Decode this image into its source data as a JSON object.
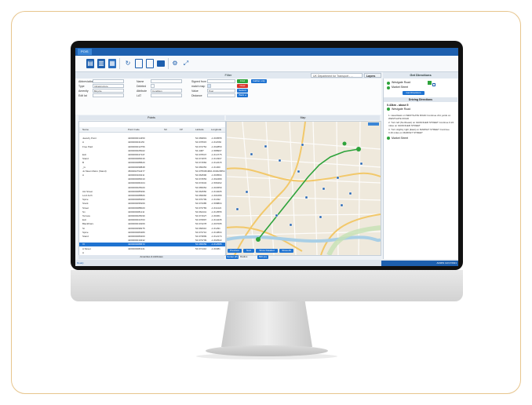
{
  "app": {
    "menu_tab": "POIS",
    "filter": {
      "title": "Filter",
      "dropdown": "UK Department for Transport - ...",
      "layer_button": "Layers query"
    },
    "form": {
      "abbreviation_label": "Abbreviation",
      "type_label": "Type",
      "amenity_label": "Amenity",
      "edit_lat_label": "Edit lat",
      "type_value": "Infrastructure",
      "amenity_value": "Bicycle",
      "name_label": "Name",
      "deleted_label": "Deleted",
      "attribute_label": "Attribute",
      "lat_label": "LAT",
      "attribute_value": "Condition",
      "signed_from_label": "Signed from",
      "match_map_label": "match map",
      "value_label": "Value",
      "distance_label": "Distance",
      "value_value": "Post",
      "btn_find": "Find",
      "btn_clear": "Clear",
      "btn_submit": "Submit",
      "btn_back": "Back ◂",
      "btn_gather": "Gather only"
    },
    "points": {
      "title": "Points",
      "columns": [
        "Name",
        "Point Code",
        "SC",
        "FP",
        "Latitude",
        "Longitude"
      ],
      "rows": [
        [
          "",
          "",
          "",
          "",
          "",
          ""
        ],
        [
          "Jewelry Point",
          "4200000014450",
          "",
          "",
          "54.969819",
          "-1.600555"
        ],
        [
          "A",
          "4200000041150",
          "",
          "",
          "54.976515",
          "-1.611560"
        ],
        [
          "Free Paid",
          "4200000012756",
          "",
          "",
          "54.974754",
          "-1.602850"
        ],
        [
          "",
          "4200000025022",
          "",
          "",
          "54.4487",
          "-1.588997"
        ],
        [
          "Exit",
          "4200000047118",
          "",
          "",
          "54.976547",
          "-1.614775"
        ],
        [
          "Stand",
          "4200000080016",
          "",
          "",
          "54.971876",
          "-1.613307"
        ],
        [
          "B",
          "4200000088620",
          "",
          "",
          "54.971584",
          "-1.612215"
        ],
        [
          "_ls",
          "4200000098848",
          "",
          "",
          "54.969353",
          "-1.61300"
        ],
        [
          "Jo Mean Metro (Stand)",
          "4500002794477",
          "",
          "",
          "54.975545/482",
          "1.603029554"
        ],
        [
          "A",
          "4200000100211",
          "",
          "",
          "54.964596",
          "-1.600594"
        ],
        [
          "",
          "4200000080010",
          "",
          "",
          "54.974553",
          "-1.602489"
        ],
        [
          "",
          "4200000082104",
          "",
          "",
          "54.974634",
          "-1.596462"
        ],
        [
          "",
          "4200000025020",
          "",
          "",
          "54.965054",
          "-1.604559"
        ],
        [
          "Ast Street",
          "4200000085396",
          "",
          "",
          "54.964550",
          "-1.610205"
        ],
        [
          "Lord Arch",
          "4200000088506",
          "",
          "",
          "54.969966",
          "-1.601689"
        ],
        [
          "Spice",
          "4200000089293",
          "",
          "",
          "54.970799",
          "-1.61032"
        ],
        [
          "Stock",
          "4200000095269",
          "",
          "",
          "54.973385",
          "-1.598804"
        ],
        [
          "Street",
          "4200000088020",
          "",
          "",
          "54.973783",
          "-1.611421"
        ],
        [
          "Sn",
          "4200000081211",
          "",
          "",
          "54.964441",
          "-1.613555"
        ],
        [
          "Terrace",
          "4200000025030",
          "",
          "",
          "54.971627",
          "-1.60361"
        ],
        [
          "Exit",
          "4200000044703",
          "",
          "",
          "54.970897",
          "-1.614235"
        ],
        [
          "Blackfriars",
          "4200000019269",
          "",
          "",
          "54.974278",
          "-1.607095"
        ],
        [
          "St",
          "4200000098275",
          "",
          "",
          "54.966910",
          "-1.61291"
        ],
        [
          "Spice",
          "4200000083280",
          "",
          "",
          "54.973710",
          "-1.613804"
        ],
        [
          "Stand",
          "4200000080200",
          "",
          "",
          "54.973899",
          "-1.612174"
        ],
        [
          "",
          "4200000019432",
          "",
          "",
          "54.973709",
          "-1.602522"
        ],
        [
          "VI",
          "4200000088672",
          "",
          "",
          "54.965059",
          "-1.612585"
        ],
        [
          "A Street",
          "4200000081941",
          "",
          "",
          "54.971410",
          "-1.60381"
        ],
        [
          "A",
          "",
          "",
          "",
          "",
          ""
        ]
      ],
      "selected_index": 27
    },
    "amenities_panel": "Amenities & Attributes",
    "map": {
      "title": "Map",
      "buttons": [
        "Previous",
        "Next",
        "Show Detailed",
        "Show All"
      ]
    },
    "map_footer": {
      "btn_center": "Center (P)",
      "radius_label": "Radius",
      "btn_go": "500 (m)"
    },
    "directions": {
      "title": "Get Directions",
      "from": "Westgate Road",
      "to": "Market Street",
      "get_button": "Get Directions",
      "section_title": "Driving Directions",
      "summary": "0.43km - about 5",
      "start": "Westgate Road",
      "steps": [
        "1. Head East on WESTGATE ROAD Continue 211 yards on WESTGATE ROAD",
        "2. Turn left (Northeast) on GRAINGER STREET Continue 0.22 miles on GRAINGER STREET",
        "3. Turn slightly right (East) on MARKET STREET Continue 0.16 miles on MARKET STREET"
      ],
      "end": "Market Street"
    },
    "status": {
      "left": "Ready",
      "right": "ADMIN  12/17/2021"
    }
  },
  "colors": {
    "brand_blue": "#1d5fae",
    "accent_blue": "#1f73d1",
    "green": "#2ea33b",
    "red": "#d9342b",
    "frame_border": "#e7c58d"
  }
}
